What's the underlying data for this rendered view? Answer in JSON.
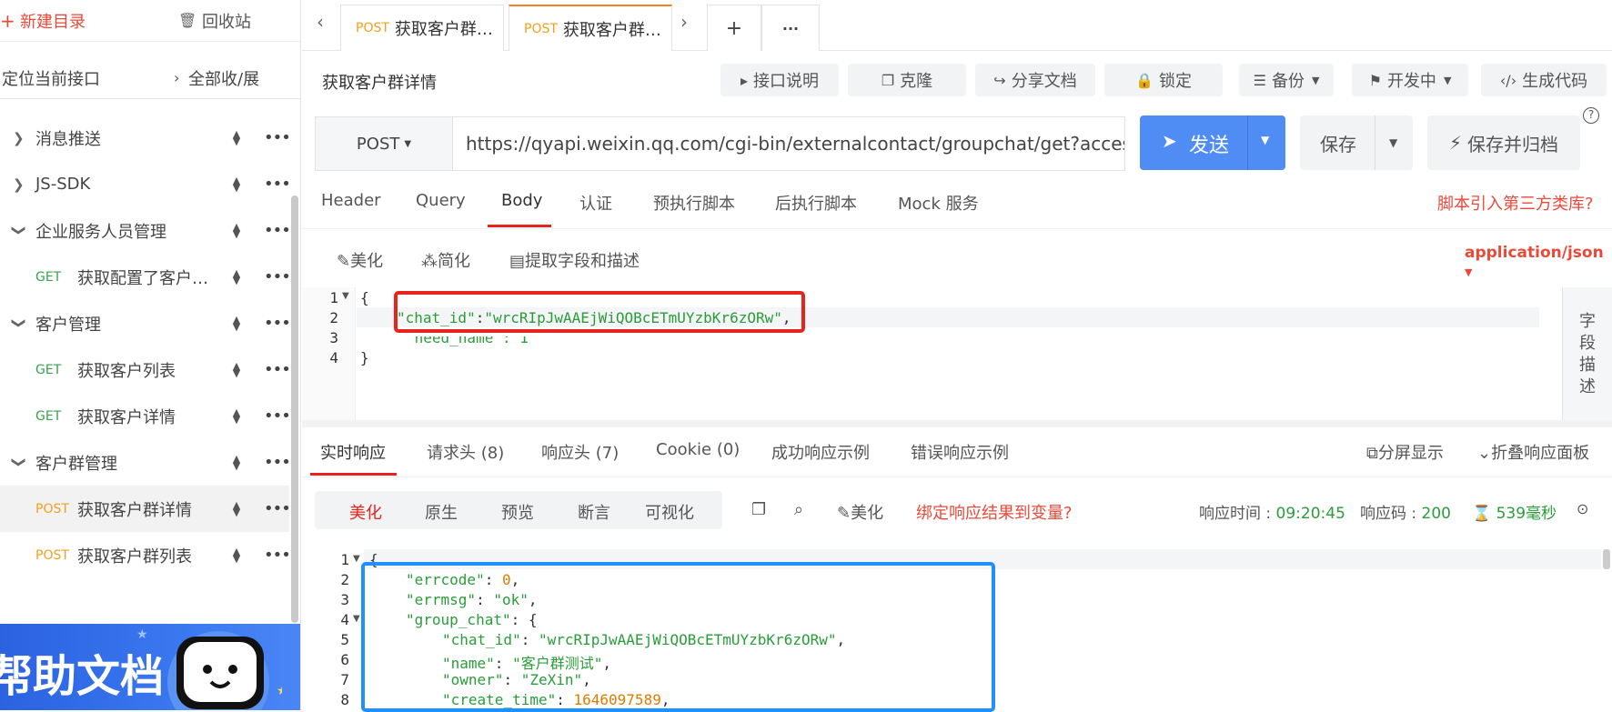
{
  "sidebar": {
    "new_dir": "新建目录",
    "recycle": "回收站",
    "locate": "定位当前接口",
    "collapse": "全部收/展",
    "items": [
      {
        "label": "消息推送",
        "type": "folder"
      },
      {
        "label": "JS-SDK",
        "type": "folder"
      },
      {
        "label": "企业服务人员管理",
        "type": "folder-open"
      },
      {
        "label": "获取配置了客户…",
        "type": "api",
        "method": "GET"
      },
      {
        "label": "客户管理",
        "type": "folder-open"
      },
      {
        "label": "获取客户列表",
        "type": "api",
        "method": "GET"
      },
      {
        "label": "获取客户详情",
        "type": "api",
        "method": "GET"
      },
      {
        "label": "客户群管理",
        "type": "folder-open"
      },
      {
        "label": "获取客户群详情",
        "type": "api",
        "method": "POST",
        "active": true
      },
      {
        "label": "获取客户群列表",
        "type": "api",
        "method": "POST"
      }
    ],
    "banner_text": "帮助文档"
  },
  "tabs": [
    {
      "method": "POST",
      "title": "获取客户群…",
      "active": false
    },
    {
      "method": "POST",
      "title": "获取客户群…",
      "active": true
    }
  ],
  "tab_add": "+",
  "tab_more": "···",
  "toolbar": {
    "api_name": "获取客户群详情",
    "doc": "接口说明",
    "clone": "克隆",
    "share": "分享文档",
    "lock": "锁定",
    "backup": "备份",
    "dev": "开发中",
    "gen_code": "生成代码"
  },
  "request": {
    "method": "POST",
    "url": "https://qyapi.weixin.qq.com/cgi-bin/externalcontact/groupchat/get?access_to",
    "send": "发送",
    "save": "保存",
    "save_archive": "保存并归档"
  },
  "req_tabs": [
    "Header",
    "Query",
    "Body",
    "认证",
    "预执行脚本",
    "后执行脚本",
    "Mock 服务"
  ],
  "third_party_link": "脚本引入第三方类库?",
  "body_tools": {
    "beautify": "美化",
    "simplify": "简化",
    "extract": "提取字段和描述",
    "content_type": "application/json"
  },
  "body_code": {
    "line1": "{",
    "chat_id_key": "\"chat_id\"",
    "chat_id_val": "\"wrcRIpJwAAEjWiQOBcETmUYzbKr6zORw\"",
    "need_name": "\"need_name\": 1",
    "line4": "}"
  },
  "field_desc": "字段描述",
  "resp_tabs": [
    "实时响应",
    "请求头 (8)",
    "响应头 (7)",
    "Cookie (0)",
    "成功响应示例",
    "错误响应示例"
  ],
  "split_view": "分屏显示",
  "fold_panel": "折叠响应面板",
  "resp_sub_tabs": [
    "美化",
    "原生",
    "预览",
    "断言",
    "可视化"
  ],
  "resp_tools": {
    "beautify": "美化",
    "bind_var": "绑定响应结果到变量?",
    "time_label": "响应时间 :",
    "time": "09:20:45",
    "code_label": "响应码 :",
    "code": "200",
    "duration": "539毫秒"
  },
  "response_code": {
    "errcode_key": "\"errcode\"",
    "errcode_val": "0",
    "errmsg_key": "\"errmsg\"",
    "errmsg_val": "\"ok\"",
    "group_chat_key": "\"group_chat\"",
    "chat_id_key": "\"chat_id\"",
    "chat_id_val": "\"wrcRIpJwAAEjWiQOBcETmUYzbKr6zORw\"",
    "name_key": "\"name\"",
    "name_val": "\"客户群测试\"",
    "owner_key": "\"owner\"",
    "owner_val": "\"ZeXin\"",
    "create_time_key": "\"create_time\"",
    "create_time_val": "1646097589"
  },
  "colors": {
    "accent": "#f58220",
    "send": "#4f8df5",
    "red_highlight": "#e8231b",
    "blue_highlight": "#1e90ff",
    "link_red": "#e84a3a"
  }
}
